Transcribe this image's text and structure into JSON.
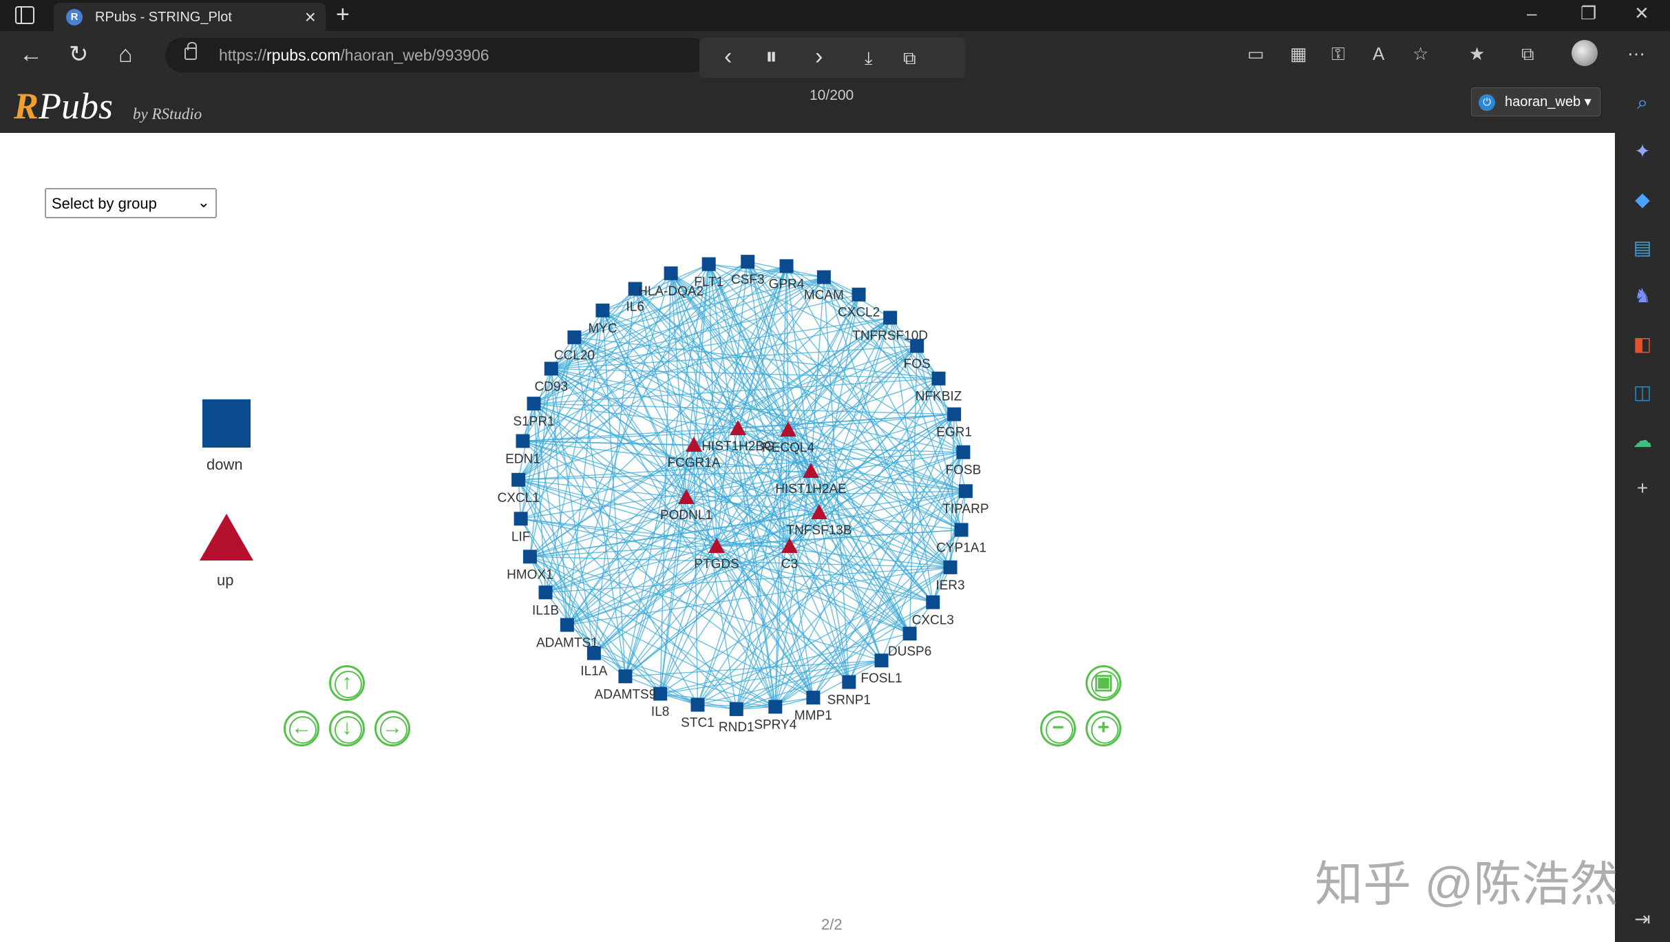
{
  "browser": {
    "tab_title": "RPubs - STRING_Plot",
    "url_scheme": "https://",
    "url_host": "rpubs.com",
    "url_path": "/haoran_web/993906"
  },
  "header": {
    "logo_r": "R",
    "logo_rest": "Pubs",
    "logo_by": "by RStudio",
    "page_indicator": "10/200",
    "username": "haoran_web"
  },
  "content": {
    "group_select": "Select by group",
    "legend": [
      {
        "shape": "square",
        "label": "down",
        "color": "#0a4a8e"
      },
      {
        "shape": "triangle",
        "label": "up",
        "color": "#b5112e"
      }
    ],
    "footer_page": "2/2"
  },
  "watermark": "知乎 @陈浩然",
  "network": {
    "edge_color": "#3aa9d8",
    "down_color": "#0a4a8e",
    "up_color": "#b5112e",
    "outer_nodes": [
      "FLT1",
      "CSF3",
      "GPR4",
      "MCAM",
      "CXCL2",
      "TNFRSF10D",
      "FOS",
      "NFKBIZ",
      "EGR1",
      "FOSB",
      "TIPARP",
      "CYP1A1",
      "IER3",
      "CXCL3",
      "DUSP6",
      "FOSL1",
      "SRNP1",
      "MMP1",
      "SPRY4",
      "RND1",
      "STC1",
      "IL8",
      "ADAMTS9",
      "IL1A",
      "ADAMTS1",
      "IL1B",
      "HMOX1",
      "LIF",
      "CXCL1",
      "EDN1",
      "S1PR1",
      "CD93",
      "CCL20",
      "MYC",
      "IL6",
      "HLA-DQA2"
    ],
    "inner_nodes": [
      "FCGR1A",
      "HIST1H2BG",
      "RECQL4",
      "HIST1H2AE",
      "PODNL1",
      "TNFSF13B",
      "PTGDS",
      "C3"
    ]
  }
}
